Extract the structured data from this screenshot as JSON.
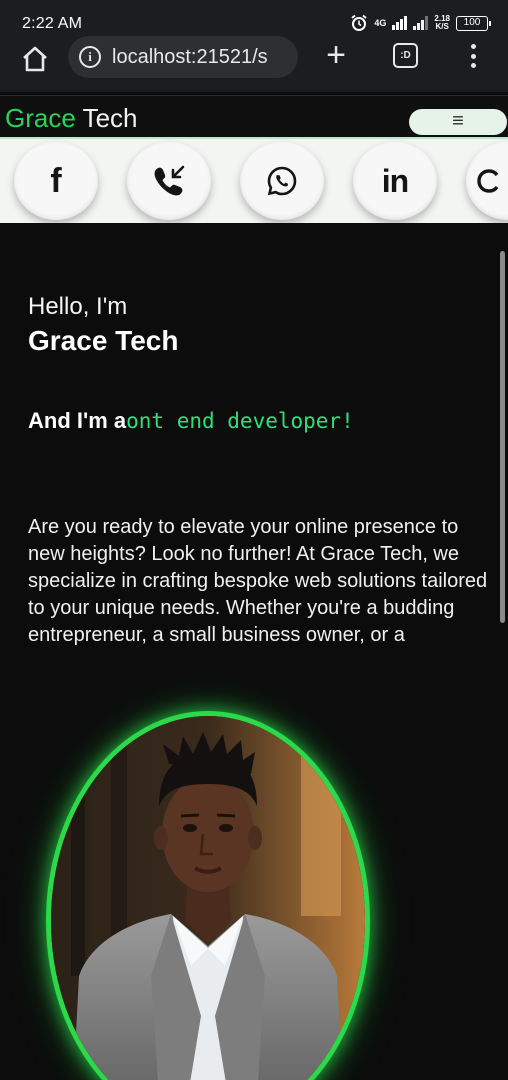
{
  "status_bar": {
    "time": "2:22 AM",
    "network": "4G",
    "speed_value": "2.18",
    "speed_unit": "K/S",
    "battery": "100"
  },
  "browser": {
    "url": "localhost:21521/s",
    "tabs_label": ":D"
  },
  "site": {
    "brand_first": "Grace",
    "brand_second": " Tech",
    "menu_icon": "hamburger-icon"
  },
  "social": [
    {
      "name": "facebook",
      "label": "f",
      "icon": "facebook-icon"
    },
    {
      "name": "phone",
      "label": "",
      "icon": "phone-icon"
    },
    {
      "name": "whatsapp",
      "label": "",
      "icon": "whatsapp-icon"
    },
    {
      "name": "linkedin",
      "label": "in",
      "icon": "linkedin-icon"
    },
    {
      "name": "github",
      "label": "",
      "icon": "github-icon"
    }
  ],
  "hero": {
    "greeting": "Hello, I'm",
    "name": "Grace Tech",
    "role_prefix": "And I'm a",
    "role_typed": "ont end developer!",
    "intro": "Are you ready to elevate your online presence to new heights? Look no further! At Grace Tech, we specialize in crafting bespoke web solutions tailored to your unique needs. Whether you're a budding entrepreneur, a small business owner, or a"
  },
  "colors": {
    "accent_green": "#27d35b",
    "typed_green": "#2fe07a",
    "background": "#0c0c0c"
  }
}
